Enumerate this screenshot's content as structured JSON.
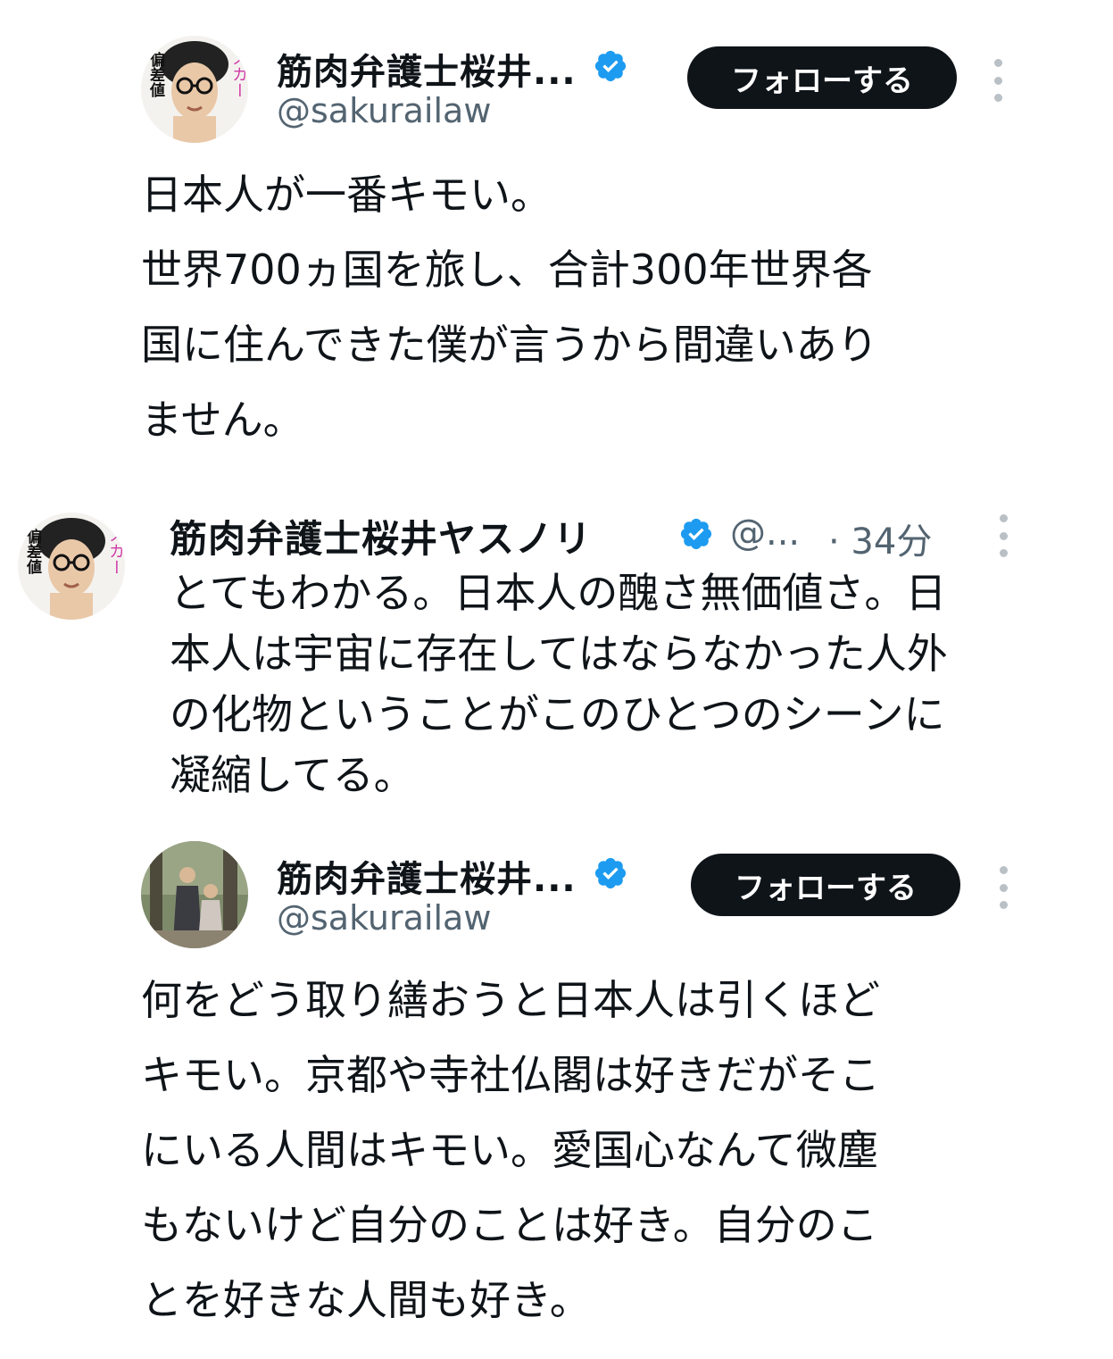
{
  "colors": {
    "verified": "#1d9bf0",
    "text": "#0f1419",
    "muted": "#536471",
    "follow_bg": "#0f1419"
  },
  "post1": {
    "author_name": "筋肉弁護士桜井...",
    "handle": "@sakurailaw",
    "follow_label": "フォローする",
    "avatar_caption_left": "偏差値",
    "avatar_caption_right": "スカー",
    "lines": [
      "日本人が一番キモい。",
      "世界700ヵ国を旅し、合計300年世界各",
      "国に住んできた僕が言うから間違いあり",
      "ません。"
    ]
  },
  "post2": {
    "author_name": "筋肉弁護士桜井ヤスノリ",
    "handle": "@...",
    "time": "· 34分",
    "avatar_caption_left": "偏差値",
    "avatar_caption_right": "スカー",
    "lines": [
      "とてもわかる。日本人の醜さ無価値さ。日",
      "本人は宇宙に存在してはならなかった人外",
      "の化物ということがこのひとつのシーンに",
      "凝縮してる。"
    ]
  },
  "post3": {
    "author_name": "筋肉弁護士桜井...",
    "handle": "@sakurailaw",
    "follow_label": "フォローする",
    "lines": [
      "何をどう取り繕おうと日本人は引くほど",
      "キモい。京都や寺社仏閣は好きだがそこ",
      "にいる人間はキモい。愛国心なんて微塵",
      "もないけど自分のことは好き。自分のこ",
      "とを好きな人間も好き。"
    ]
  }
}
